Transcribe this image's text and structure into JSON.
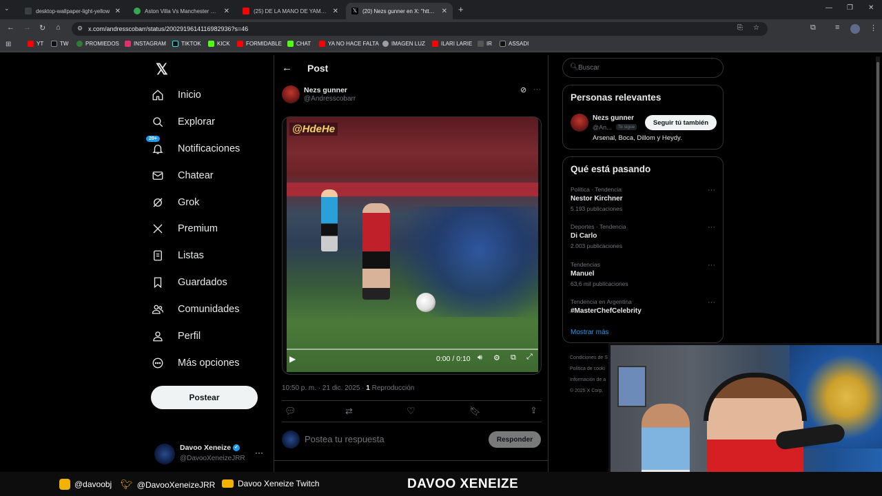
{
  "browser": {
    "tabs": [
      {
        "title": "desktop-wallpaper-light-yellow",
        "fav": "#3c4043"
      },
      {
        "title": "Aston Villa Vs Manchester Unit",
        "fav": "#34a853"
      },
      {
        "title": "(25) DE LA MANO DE YAMAL, E",
        "fav": "#ff0000"
      },
      {
        "title": "(20) Nezs gunner en X: \"https://",
        "fav": "#000000"
      }
    ],
    "url": "x.com/andresscobarr/status/2002919614116982936?s=46",
    "bookmarks": [
      {
        "label": "YT",
        "color": "#ff0000"
      },
      {
        "label": "TW",
        "color": "#000000"
      },
      {
        "label": "PROMIEDOS",
        "color": "#2e7d32"
      },
      {
        "label": "INSTAGRAM",
        "color": "#e1306c"
      },
      {
        "label": "TIKTOK",
        "color": "#000000"
      },
      {
        "label": "KICK",
        "color": "#53fc18"
      },
      {
        "label": "FORMIDABLE",
        "color": "#ff0000"
      },
      {
        "label": "CHAT",
        "color": "#53fc18"
      },
      {
        "label": "YA NO HACE FALTA",
        "color": "#ff0000"
      },
      {
        "label": "IMAGEN LUZ",
        "color": "#9aa0a6"
      },
      {
        "label": "ILARI LARIE",
        "color": "#ff0000"
      },
      {
        "label": "IR",
        "color": "#555555"
      },
      {
        "label": "ASSADI",
        "color": "#000000"
      }
    ]
  },
  "sidebar": {
    "nav": [
      {
        "label": "Inicio",
        "icon": "home-icon"
      },
      {
        "label": "Explorar",
        "icon": "search-icon"
      },
      {
        "label": "Notificaciones",
        "icon": "bell-icon"
      },
      {
        "label": "Chatear",
        "icon": "mail-icon"
      },
      {
        "label": "Grok",
        "icon": "grok-icon"
      },
      {
        "label": "Premium",
        "icon": "x-logo-icon"
      },
      {
        "label": "Listas",
        "icon": "list-icon"
      },
      {
        "label": "Guardados",
        "icon": "bookmark-icon"
      },
      {
        "label": "Comunidades",
        "icon": "people-icon"
      },
      {
        "label": "Perfil",
        "icon": "person-icon"
      },
      {
        "label": "Más opciones",
        "icon": "more-circle-icon"
      }
    ],
    "notif_badge": "20+",
    "post_button": "Postear",
    "account": {
      "name": "Davoo Xeneize",
      "handle": "@DavooXeneizeJRR"
    }
  },
  "post": {
    "header_title": "Post",
    "author_name": "Nezs gunner",
    "author_handle": "@Andresscobarr",
    "video_watermark": "@HdeHe",
    "video_time": "0:00 / 0:10",
    "date": "10:50 p. m. · 21 dic. 2025 · ",
    "views_count": "1",
    "views_label": " Reproducción",
    "reply_placeholder": "Postea tu respuesta",
    "reply_button": "Responder"
  },
  "right": {
    "search_placeholder": "Buscar",
    "relevant_title": "Personas relevantes",
    "relevant": {
      "name": "Nezs gunner",
      "handle": "@An...",
      "follows_you": "Te sigue",
      "follow_button": "Seguir tú también",
      "bio": "Arsenal, Boca, Dillom y Heydy."
    },
    "trending_title": "Qué está pasando",
    "trends": [
      {
        "context": "Política · Tendencia",
        "name": "Nestor Kirchner",
        "count": "5.193 publicaciones"
      },
      {
        "context": "Deportes · Tendencia",
        "name": "Di Carlo",
        "count": "2.003 publicaciones"
      },
      {
        "context": "Tendencias",
        "name": "Manuel",
        "count": "63,6 mil publicaciones"
      },
      {
        "context": "Tendencia en Argentina",
        "name": "#MasterChefCelebrity",
        "count": ""
      }
    ],
    "show_more": "Mostrar más",
    "footer_links": [
      "Condiciones de S",
      "Política de cooki",
      "Información de a",
      "© 2025 X Corp."
    ]
  },
  "stream_footer": {
    "instagram": "@davoobj",
    "twitter": "@DavooXeneizeJRR",
    "youtube": "Davoo Xeneize Twitch",
    "brand": "DAVOO XENEIZE"
  },
  "colors": {
    "accent": "#1d9bf0",
    "text_dim": "#71767b",
    "border": "#2f3336"
  }
}
